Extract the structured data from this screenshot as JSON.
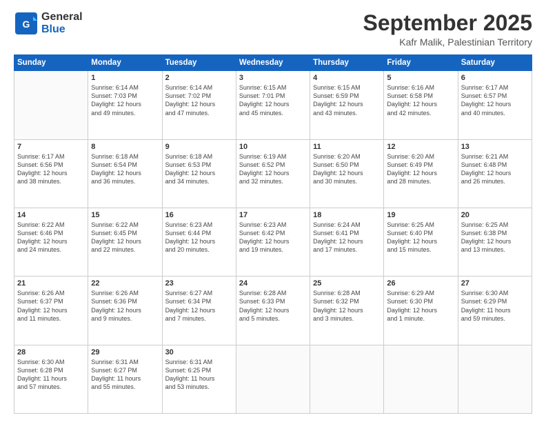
{
  "header": {
    "logo_general": "General",
    "logo_blue": "Blue",
    "month": "September 2025",
    "location": "Kafr Malik, Palestinian Territory"
  },
  "weekdays": [
    "Sunday",
    "Monday",
    "Tuesday",
    "Wednesday",
    "Thursday",
    "Friday",
    "Saturday"
  ],
  "weeks": [
    [
      {
        "day": "",
        "info": ""
      },
      {
        "day": "1",
        "info": "Sunrise: 6:14 AM\nSunset: 7:03 PM\nDaylight: 12 hours\nand 49 minutes."
      },
      {
        "day": "2",
        "info": "Sunrise: 6:14 AM\nSunset: 7:02 PM\nDaylight: 12 hours\nand 47 minutes."
      },
      {
        "day": "3",
        "info": "Sunrise: 6:15 AM\nSunset: 7:01 PM\nDaylight: 12 hours\nand 45 minutes."
      },
      {
        "day": "4",
        "info": "Sunrise: 6:15 AM\nSunset: 6:59 PM\nDaylight: 12 hours\nand 43 minutes."
      },
      {
        "day": "5",
        "info": "Sunrise: 6:16 AM\nSunset: 6:58 PM\nDaylight: 12 hours\nand 42 minutes."
      },
      {
        "day": "6",
        "info": "Sunrise: 6:17 AM\nSunset: 6:57 PM\nDaylight: 12 hours\nand 40 minutes."
      }
    ],
    [
      {
        "day": "7",
        "info": "Sunrise: 6:17 AM\nSunset: 6:56 PM\nDaylight: 12 hours\nand 38 minutes."
      },
      {
        "day": "8",
        "info": "Sunrise: 6:18 AM\nSunset: 6:54 PM\nDaylight: 12 hours\nand 36 minutes."
      },
      {
        "day": "9",
        "info": "Sunrise: 6:18 AM\nSunset: 6:53 PM\nDaylight: 12 hours\nand 34 minutes."
      },
      {
        "day": "10",
        "info": "Sunrise: 6:19 AM\nSunset: 6:52 PM\nDaylight: 12 hours\nand 32 minutes."
      },
      {
        "day": "11",
        "info": "Sunrise: 6:20 AM\nSunset: 6:50 PM\nDaylight: 12 hours\nand 30 minutes."
      },
      {
        "day": "12",
        "info": "Sunrise: 6:20 AM\nSunset: 6:49 PM\nDaylight: 12 hours\nand 28 minutes."
      },
      {
        "day": "13",
        "info": "Sunrise: 6:21 AM\nSunset: 6:48 PM\nDaylight: 12 hours\nand 26 minutes."
      }
    ],
    [
      {
        "day": "14",
        "info": "Sunrise: 6:22 AM\nSunset: 6:46 PM\nDaylight: 12 hours\nand 24 minutes."
      },
      {
        "day": "15",
        "info": "Sunrise: 6:22 AM\nSunset: 6:45 PM\nDaylight: 12 hours\nand 22 minutes."
      },
      {
        "day": "16",
        "info": "Sunrise: 6:23 AM\nSunset: 6:44 PM\nDaylight: 12 hours\nand 20 minutes."
      },
      {
        "day": "17",
        "info": "Sunrise: 6:23 AM\nSunset: 6:42 PM\nDaylight: 12 hours\nand 19 minutes."
      },
      {
        "day": "18",
        "info": "Sunrise: 6:24 AM\nSunset: 6:41 PM\nDaylight: 12 hours\nand 17 minutes."
      },
      {
        "day": "19",
        "info": "Sunrise: 6:25 AM\nSunset: 6:40 PM\nDaylight: 12 hours\nand 15 minutes."
      },
      {
        "day": "20",
        "info": "Sunrise: 6:25 AM\nSunset: 6:38 PM\nDaylight: 12 hours\nand 13 minutes."
      }
    ],
    [
      {
        "day": "21",
        "info": "Sunrise: 6:26 AM\nSunset: 6:37 PM\nDaylight: 12 hours\nand 11 minutes."
      },
      {
        "day": "22",
        "info": "Sunrise: 6:26 AM\nSunset: 6:36 PM\nDaylight: 12 hours\nand 9 minutes."
      },
      {
        "day": "23",
        "info": "Sunrise: 6:27 AM\nSunset: 6:34 PM\nDaylight: 12 hours\nand 7 minutes."
      },
      {
        "day": "24",
        "info": "Sunrise: 6:28 AM\nSunset: 6:33 PM\nDaylight: 12 hours\nand 5 minutes."
      },
      {
        "day": "25",
        "info": "Sunrise: 6:28 AM\nSunset: 6:32 PM\nDaylight: 12 hours\nand 3 minutes."
      },
      {
        "day": "26",
        "info": "Sunrise: 6:29 AM\nSunset: 6:30 PM\nDaylight: 12 hours\nand 1 minute."
      },
      {
        "day": "27",
        "info": "Sunrise: 6:30 AM\nSunset: 6:29 PM\nDaylight: 11 hours\nand 59 minutes."
      }
    ],
    [
      {
        "day": "28",
        "info": "Sunrise: 6:30 AM\nSunset: 6:28 PM\nDaylight: 11 hours\nand 57 minutes."
      },
      {
        "day": "29",
        "info": "Sunrise: 6:31 AM\nSunset: 6:27 PM\nDaylight: 11 hours\nand 55 minutes."
      },
      {
        "day": "30",
        "info": "Sunrise: 6:31 AM\nSunset: 6:25 PM\nDaylight: 11 hours\nand 53 minutes."
      },
      {
        "day": "",
        "info": ""
      },
      {
        "day": "",
        "info": ""
      },
      {
        "day": "",
        "info": ""
      },
      {
        "day": "",
        "info": ""
      }
    ]
  ]
}
